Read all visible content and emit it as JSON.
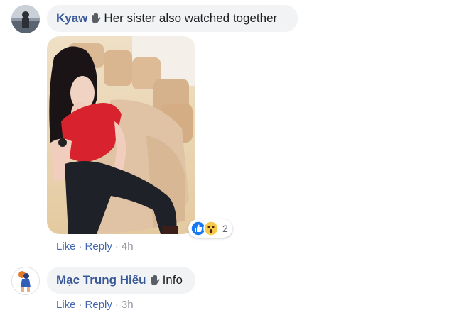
{
  "comments": [
    {
      "author": "Kyaw",
      "text": "Her sister also watched together",
      "icon": "wave-hand-icon",
      "photo": "photo-of-girl-in-red-top-sitting-on-chair",
      "reactions": {
        "icons": [
          "like-icon",
          "wow-icon"
        ],
        "count": "2"
      },
      "actions": {
        "like": "Like",
        "reply": "Reply",
        "time": "4h",
        "separator": "·"
      }
    },
    {
      "author": "Mạc Trung Hiếu",
      "text": "Info",
      "icon": "wave-hand-icon",
      "actions": {
        "like": "Like",
        "reply": "Reply",
        "time": "3h",
        "separator": "·"
      }
    }
  ],
  "colors": {
    "author": "#385898",
    "link": "#4267b2",
    "bubble": "#f2f3f5",
    "meta": "#90949c",
    "like_blue": "#1877f2"
  }
}
